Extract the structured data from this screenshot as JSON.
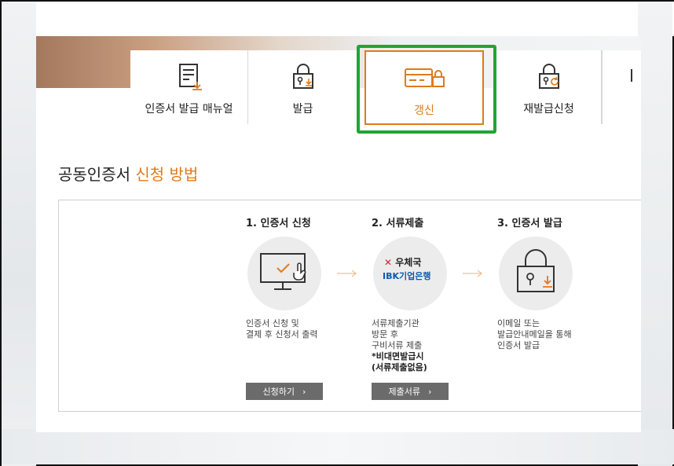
{
  "tabs": [
    {
      "label": "인증서 발급 매뉴얼",
      "icon": "document-download-icon"
    },
    {
      "label": "발급",
      "icon": "lock-download-icon"
    },
    {
      "label": "갱신",
      "icon": "card-lock-icon",
      "active": true
    },
    {
      "label": "재발급신청",
      "icon": "lock-refresh-icon"
    }
  ],
  "section": {
    "title_plain": "공동인증서 ",
    "title_highlight": "신청 방법"
  },
  "steps": [
    {
      "title": "1. 인증서 신청",
      "icon": "monitor-check-icon",
      "desc": [
        "인증서 신청 및",
        "결제 후 신청서 출력"
      ],
      "button": "신청하기"
    },
    {
      "title": "2. 서류제출",
      "icon": "bank-logos-icon",
      "logo_post": "우체국",
      "logo_ibk": "IBK기업은행",
      "desc": [
        "서류제출기관",
        "방문 후",
        "구비서류 제출"
      ],
      "desc_strong": [
        "*비대면발급시",
        "(서류제출없음)"
      ],
      "button": "제출서류"
    },
    {
      "title": "3. 인증서 발급",
      "icon": "lock-download-icon",
      "desc": [
        "이메일 또는",
        "발급안내메일을 통해",
        "인증서 발급"
      ]
    }
  ],
  "colors": {
    "accent": "#e07a1a",
    "highlight_outline": "#21a535",
    "button_bg": "#6b6b6b"
  }
}
